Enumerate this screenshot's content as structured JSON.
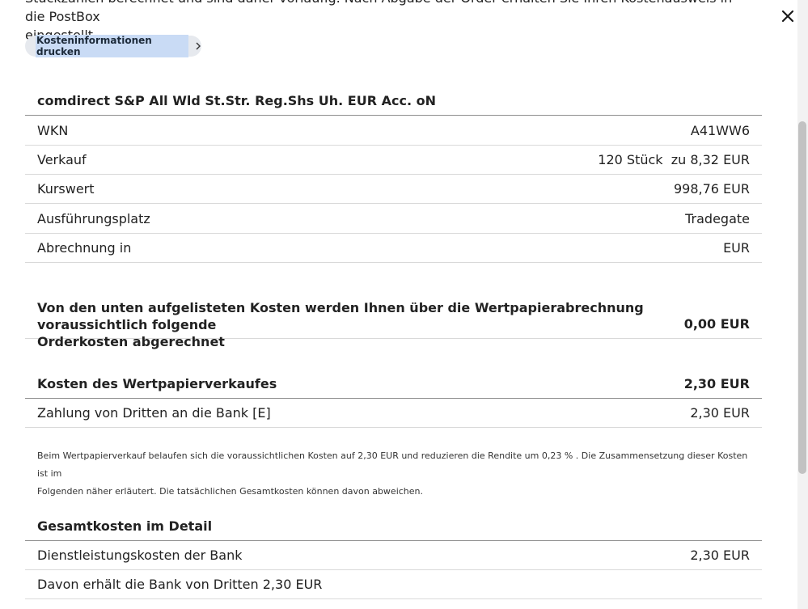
{
  "intro": {
    "line1": "Stückzahlen berechnet und sind daher vorläufig. Nach Abgabe der Order erhalten Sie Ihren Kostenausweis in die PostBox",
    "line2": "eingestellt."
  },
  "print_button": {
    "label": "Kosteninformationen drucken"
  },
  "security": {
    "title": "comdirect S&P All Wld St.Str. Reg.Shs Uh. EUR Acc. oN",
    "rows": [
      {
        "label": "WKN",
        "value": "A41WW6"
      },
      {
        "label": "Verkauf",
        "value": "120 Stück  zu 8,32 EUR"
      },
      {
        "label": "Kurswert",
        "value": "998,76 EUR"
      },
      {
        "label": "Ausführungsplatz",
        "value": "Tradegate"
      },
      {
        "label": "Abrechnung in",
        "value": "EUR"
      }
    ]
  },
  "ordercosts": {
    "text_line1": "Von den unten aufgelisteten Kosten werden Ihnen über die Wertpapierabrechnung voraussichtlich folgende",
    "text_line2": "Orderkosten abgerechnet",
    "value": "0,00 EUR"
  },
  "sale_costs": {
    "title": "Kosten des Wertpapierverkaufes",
    "title_value": "2,30 EUR",
    "rows": [
      {
        "label": "Zahlung von Dritten an die Bank [E]",
        "value": "2,30 EUR"
      }
    ],
    "note_line1": "Beim Wertpapierverkauf belaufen sich die voraussichtlichen Kosten auf 2,30 EUR und reduzieren die Rendite um 0,23 % . Die Zusammensetzung dieser Kosten ist im",
    "note_line2": "Folgenden näher erläutert. Die tatsächlichen Gesamtkosten können davon abweichen."
  },
  "total_detail": {
    "title": "Gesamtkosten im Detail",
    "rows": [
      {
        "label": "Dienstleistungskosten der Bank",
        "value": "2,30 EUR"
      },
      {
        "label": "Davon erhält die Bank von Dritten 2,30 EUR",
        "value": ""
      }
    ]
  },
  "icons": {
    "close": "close-icon",
    "chevron": "chevron-right-icon"
  }
}
